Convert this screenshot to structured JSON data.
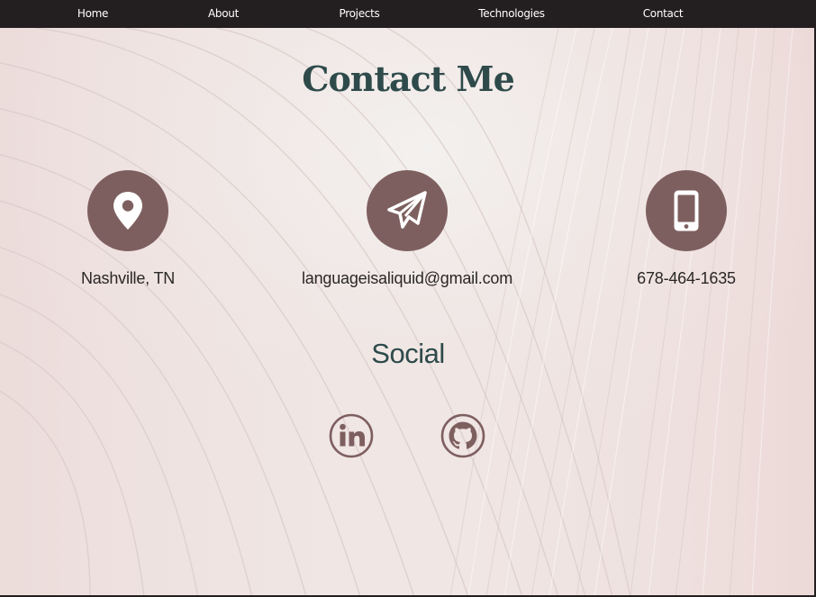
{
  "nav": {
    "items": [
      {
        "label": "Home"
      },
      {
        "label": "About"
      },
      {
        "label": "Projects"
      },
      {
        "label": "Technologies"
      },
      {
        "label": "Contact"
      }
    ]
  },
  "contact": {
    "title": "Contact Me",
    "location": {
      "icon": "map-pin-icon",
      "text": "Nashville, TN"
    },
    "email": {
      "icon": "paper-plane-icon",
      "text": "languageisaliquid@gmail.com"
    },
    "phone": {
      "icon": "mobile-phone-icon",
      "text": "678-464-1635"
    }
  },
  "social": {
    "title": "Social",
    "links": [
      {
        "icon": "linkedin-icon"
      },
      {
        "icon": "github-icon"
      }
    ]
  },
  "colors": {
    "navbar": "#231e20",
    "accent": "#7e5f5f",
    "heading": "#2e4a4a",
    "background": "#efe3e1"
  }
}
